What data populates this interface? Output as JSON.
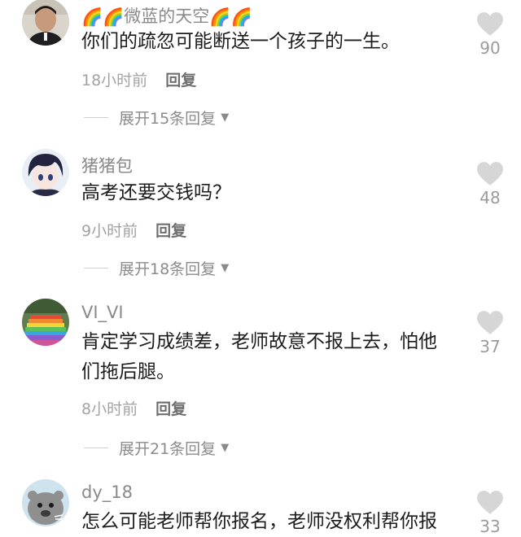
{
  "comments": [
    {
      "username": "微蓝的天空",
      "rainbow_emoji": "🌈🌈",
      "text": "你们的疏忽可能断送一个孩子的一生。",
      "time": "18小时前",
      "reply_label": "回复",
      "expand_label": "展开15条回复",
      "likes": "90",
      "avatar_icon": "man-portrait-icon"
    },
    {
      "username": "猪猪包",
      "text": "高考还要交钱吗？",
      "time": "9小时前",
      "reply_label": "回复",
      "expand_label": "展开18条回复",
      "likes": "48",
      "avatar_icon": "anime-boy-icon"
    },
    {
      "username": "VI_VI",
      "text": "肯定学习成绩差，老师故意不报上去，怕他们拖后腿。",
      "time": "8小时前",
      "reply_label": "回复",
      "expand_label": "展开21条回复",
      "likes": "37",
      "avatar_icon": "rainbow-stairs-icon"
    },
    {
      "username": "dy_18",
      "text": "怎么可能老师帮你报名，老师没权利帮你报",
      "likes": "33",
      "avatar_icon": "cartoon-seal-icon"
    }
  ],
  "colors": {
    "heart": "#d6d6d6",
    "text": "#1c1c1c",
    "muted": "#a3a3a3"
  }
}
